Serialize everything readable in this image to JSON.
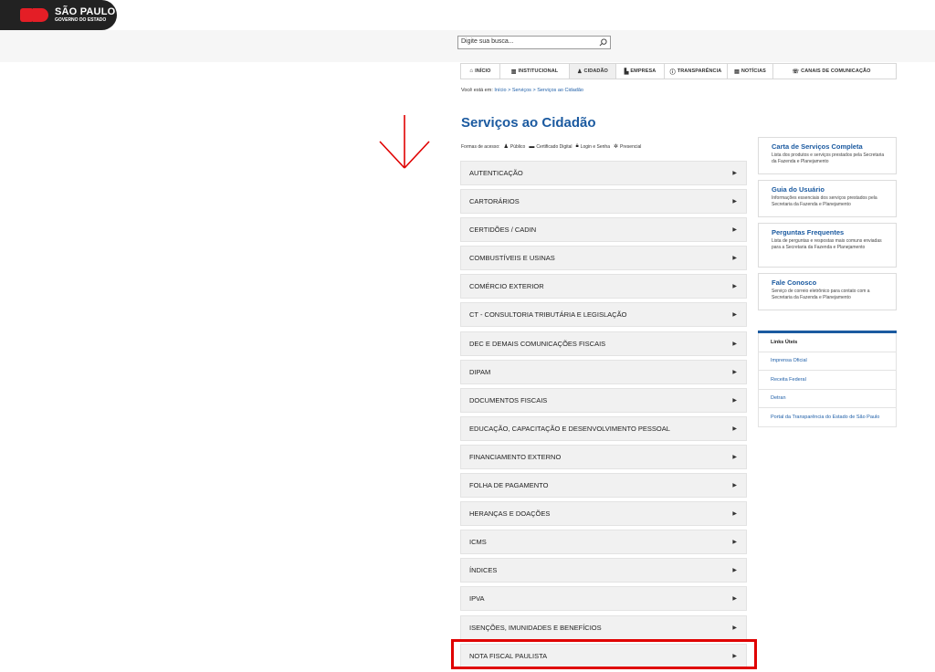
{
  "brand": {
    "line1": "SÃO PAULO",
    "line2": "GOVERNO DO ESTADO"
  },
  "search": {
    "placeholder": "Digite sua busca..."
  },
  "nav": [
    {
      "icon": "home-icon",
      "glyph": "⌂",
      "label": "INÍCIO"
    },
    {
      "icon": "building-icon",
      "glyph": "▥",
      "label": "INSTITUCIONAL"
    },
    {
      "icon": "users-icon",
      "glyph": "♟",
      "label": "CIDADÃO"
    },
    {
      "icon": "chart-icon",
      "glyph": "▙",
      "label": "EMPRESA"
    },
    {
      "icon": "info-icon",
      "glyph": "ⓘ",
      "label": "TRANSPARÊNCIA"
    },
    {
      "icon": "newspaper-icon",
      "glyph": "▤",
      "label": "NOTÍCIAS"
    },
    {
      "icon": "phone-icon",
      "glyph": "☏",
      "label": "CANAIS DE COMUNICAÇÃO"
    }
  ],
  "breadcrumb": {
    "prefix": "Você está em:",
    "items": [
      "Início",
      "Serviços",
      "Serviços ao Cidadão"
    ],
    "sep": ">"
  },
  "page_title": "Serviços ao Cidadão",
  "access": {
    "label": "Formas de acesso:",
    "items": [
      {
        "icon": "users-icon",
        "glyph": "♟",
        "label": "Público"
      },
      {
        "icon": "card-icon",
        "glyph": "▬",
        "label": "Certificado Digital"
      },
      {
        "icon": "lock-icon",
        "glyph": "🔒︎",
        "label": "Login e Senha"
      },
      {
        "icon": "gear-icon",
        "glyph": "✲",
        "label": "Presencial"
      }
    ]
  },
  "services": [
    "AUTENTICAÇÃO",
    "CARTORÁRIOS",
    "CERTIDÕES / CADIN",
    "COMBUSTÍVEIS E USINAS",
    "COMÉRCIO EXTERIOR",
    "CT - CONSULTORIA TRIBUTÁRIA E LEGISLAÇÃO",
    "DEC E DEMAIS COMUNICAÇÕES FISCAIS",
    "DIPAM",
    "DOCUMENTOS FISCAIS",
    "EDUCAÇÃO, CAPACITAÇÃO E DESENVOLVIMENTO PESSOAL",
    "FINANCIAMENTO EXTERNO",
    "FOLHA DE PAGAMENTO",
    "HERANÇAS E DOAÇÕES",
    "ICMS",
    "ÍNDICES",
    "IPVA",
    "ISENÇÕES, IMUNIDADES E BENEFÍCIOS",
    "NOTA FISCAL PAULISTA"
  ],
  "sidebar_cards": [
    {
      "title": "Carta de Serviços Completa",
      "desc": "Lista dos produtos e serviços prestados pela Secretaria da Fazenda e Planejamento"
    },
    {
      "title": "Guia do Usuário",
      "desc": "Informações essenciais dos serviços prestados pela Secretaria da Fazenda e Planejamento"
    },
    {
      "title": "Perguntas Frequentes",
      "desc": "Lista de perguntas e respostas mais comuns enviadas para a Secretaria da Fazenda e Planejamento"
    },
    {
      "title": "Fale Conosco",
      "desc": "Serviço de correio eletrônico para contato com a Secretaria da Fazenda e Planejamento"
    }
  ],
  "links": {
    "title": "Links Úteis",
    "items": [
      "Imprensa Oficial",
      "Receita Federal",
      "Detran",
      "Portal da Transparência do Estado de São Paulo"
    ]
  },
  "colors": {
    "accent": "#1b5aa0",
    "highlight": "#e00000",
    "row_bg": "#f1f1f1"
  }
}
